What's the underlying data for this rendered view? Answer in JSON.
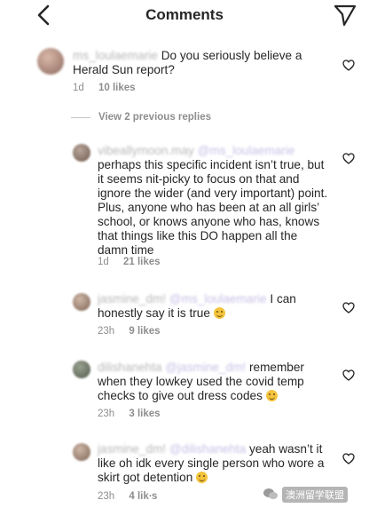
{
  "header": {
    "title": "Comments",
    "back_icon": "chevron-left-icon",
    "share_icon": "paper-plane-icon"
  },
  "comments": [
    {
      "username": "ms_loulaemarie",
      "text": "Do you seriously believe a Herald Sun report?",
      "time": "1d",
      "likes": "10 likes"
    },
    {
      "username": "vibeallymoon.may",
      "mention": "@ms_loulaemarie",
      "text": "perhaps this specific incident isn’t true, but it seems nit-picky to focus on that and ignore the wider (and very important) point. Plus, anyone who has been at an all girls’ school, or knows anyone who has, knows that things like this DO happen all the damn time",
      "time": "1d",
      "likes": "21 likes"
    },
    {
      "username": "jasmine_dm!",
      "mention": "@ms_loulaemarie",
      "text": "I can honestly say it is true",
      "time": "23h",
      "likes": "9 likes"
    },
    {
      "username": "dilishanehta",
      "mention": "@jasmine_dm!",
      "text": "remember when they lowkey used the covid temp checks to give out dress codes",
      "time": "23h",
      "likes": "3 likes"
    },
    {
      "username": "jasmine_dm!",
      "mention": "@dilishanehta",
      "text": "yeah wasn’t it like oh idk every single person who wore a skirt got detention",
      "time": "23h",
      "likes": "4 lik∙s"
    }
  ],
  "view_replies": "View 2 previous replies",
  "watermark": "澳洲留学联盟"
}
